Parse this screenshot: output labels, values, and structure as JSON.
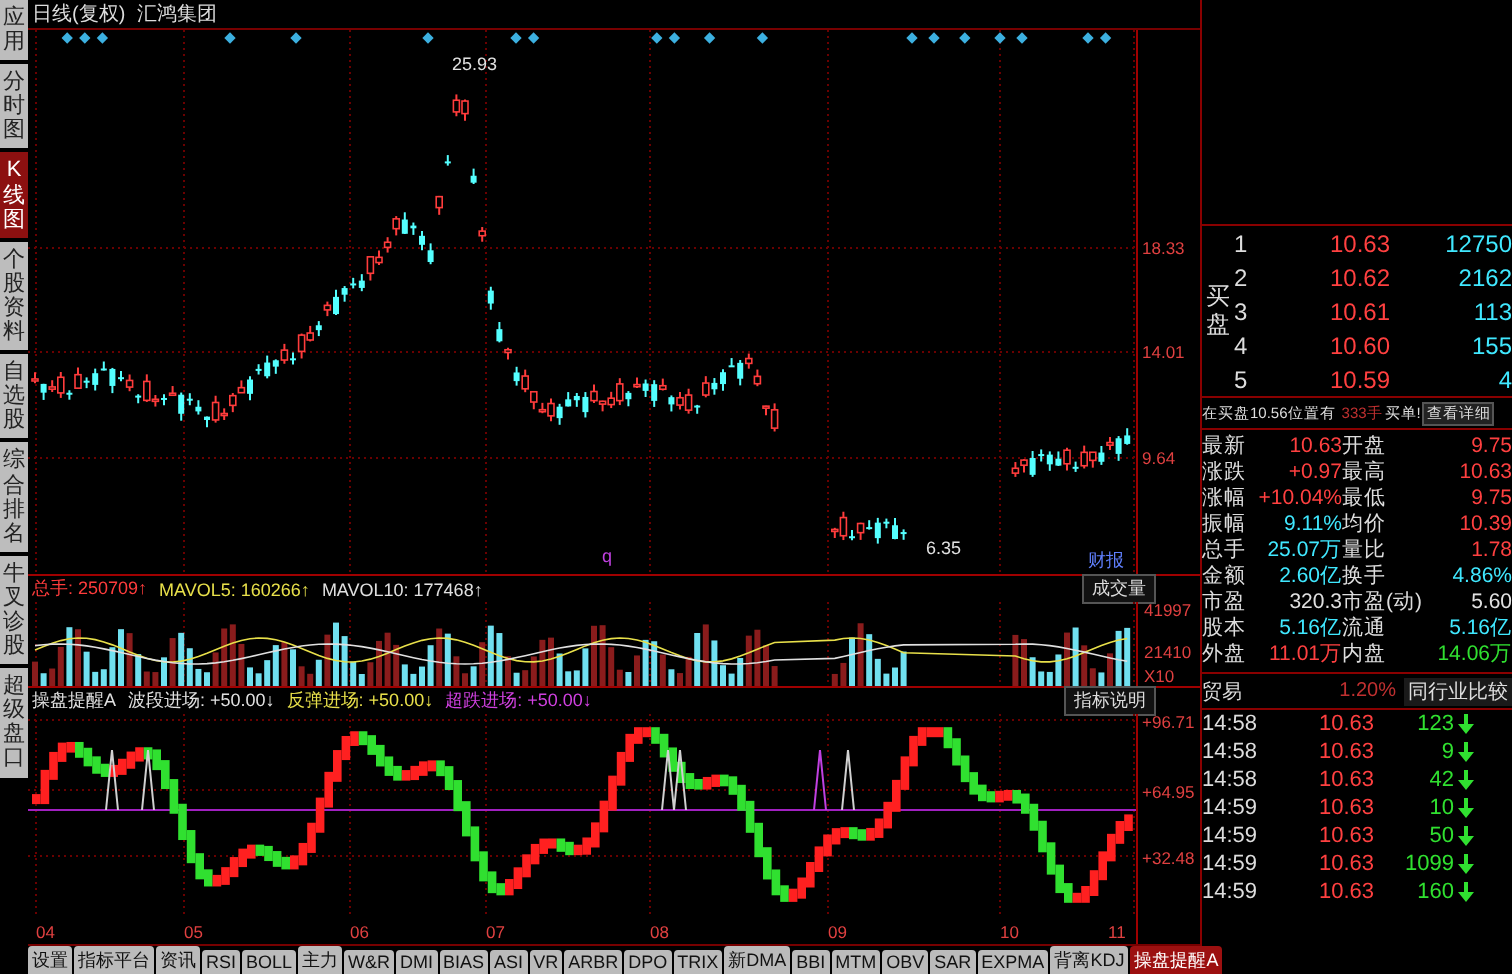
{
  "sidebar": {
    "items": [
      {
        "label": "应用",
        "selected": false
      },
      {
        "label": "分时图",
        "selected": false
      },
      {
        "label": "K线图",
        "selected": true
      },
      {
        "label": "个股资料",
        "selected": false
      },
      {
        "label": "自选股",
        "selected": false
      },
      {
        "label": "综合排名",
        "selected": false
      },
      {
        "label": "牛叉诊股",
        "selected": false
      },
      {
        "label": "超级盘口",
        "selected": false
      }
    ]
  },
  "chart_header": {
    "period": "日线(复权)",
    "stock_name": "汇鸿集团"
  },
  "price_chart": {
    "axis_labels": [
      "18.33",
      "14.01",
      "9.64"
    ],
    "high_label": "25.93",
    "low_label": "6.35",
    "marker": "q",
    "badge": "财报"
  },
  "volume_panel": {
    "legend": [
      {
        "name": "总手:",
        "value": "250709↑",
        "color": "#ff3c3c"
      },
      {
        "name": "MAVOL5:",
        "value": "160266↑",
        "color": "#e8e04a"
      },
      {
        "name": "MAVOL10:",
        "value": "177468↑",
        "color": "#e0e0e0"
      }
    ],
    "selector": "成交量",
    "axis_labels": [
      "41997",
      "21410",
      "X10"
    ]
  },
  "indicator_panel": {
    "name": "操盘提醒A",
    "legend": [
      {
        "name": "波段进场:",
        "value": "+50.00↓",
        "color": "#e0e0e0"
      },
      {
        "name": "反弹进场:",
        "value": "+50.00↓",
        "color": "#e8e04a"
      },
      {
        "name": "超跌进场:",
        "value": "+50.00↓",
        "color": "#d040e0"
      }
    ],
    "button": "指标说明",
    "axis_labels": [
      "+96.71",
      "+64.95",
      "+32.48"
    ]
  },
  "x_axis": {
    "labels": [
      "04",
      "05",
      "06",
      "07",
      "08",
      "09",
      "10",
      "11"
    ]
  },
  "tabs": [
    {
      "label": "设置",
      "selected": false
    },
    {
      "label": "指标平台",
      "selected": false
    },
    {
      "label": "资讯",
      "selected": false
    },
    {
      "label": "RSI",
      "selected": false
    },
    {
      "label": "BOLL",
      "selected": false
    },
    {
      "label": "主力",
      "selected": false
    },
    {
      "label": "W&R",
      "selected": false
    },
    {
      "label": "DMI",
      "selected": false
    },
    {
      "label": "BIAS",
      "selected": false
    },
    {
      "label": "ASI",
      "selected": false
    },
    {
      "label": "VR",
      "selected": false
    },
    {
      "label": "ARBR",
      "selected": false
    },
    {
      "label": "DPO",
      "selected": false
    },
    {
      "label": "TRIX",
      "selected": false
    },
    {
      "label": "新DMA",
      "selected": false
    },
    {
      "label": "BBI",
      "selected": false
    },
    {
      "label": "MTM",
      "selected": false
    },
    {
      "label": "OBV",
      "selected": false
    },
    {
      "label": "SAR",
      "selected": false
    },
    {
      "label": "EXPMA",
      "selected": false
    },
    {
      "label": "背离KDJ",
      "selected": false
    },
    {
      "label": "操盘提醒A",
      "selected": true
    }
  ],
  "order_book": {
    "side_label": "买盘",
    "rows": [
      {
        "level": "1",
        "price": "10.63",
        "volume": "12750"
      },
      {
        "level": "2",
        "price": "10.62",
        "volume": "2162"
      },
      {
        "level": "3",
        "price": "10.61",
        "volume": "113"
      },
      {
        "level": "4",
        "price": "10.60",
        "volume": "155"
      },
      {
        "level": "5",
        "price": "10.59",
        "volume": "4"
      }
    ]
  },
  "notice": {
    "text": "在买盘10.56位置有",
    "volume": "333手",
    "alert": "买单!",
    "link": "查看详细"
  },
  "quote": [
    {
      "label": "最新",
      "value": "10.63",
      "color": "#ff4040"
    },
    {
      "label": "开盘",
      "value": "9.75",
      "color": "#ff4040"
    },
    {
      "label": "涨跌",
      "value": "+0.97",
      "color": "#ff4040"
    },
    {
      "label": "最高",
      "value": "10.63",
      "color": "#ff4040"
    },
    {
      "label": "涨幅",
      "value": "+10.04%",
      "color": "#ff4040"
    },
    {
      "label": "最低",
      "value": "9.75",
      "color": "#ff4040"
    },
    {
      "label": "振幅",
      "value": "9.11%",
      "color": "#40e8ff"
    },
    {
      "label": "均价",
      "value": "10.39",
      "color": "#ff4040"
    },
    {
      "label": "总手",
      "value": "25.07万",
      "color": "#40e8ff"
    },
    {
      "label": "量比",
      "value": "1.78",
      "color": "#ff4040"
    },
    {
      "label": "金额",
      "value": "2.60亿",
      "color": "#40e8ff"
    },
    {
      "label": "换手",
      "value": "4.86%",
      "color": "#40e8ff"
    },
    {
      "label": "市盈",
      "value": "320.3",
      "color": "#e0e0e0"
    },
    {
      "label": "市盈(动)",
      "value": "5.60",
      "color": "#e0e0e0"
    },
    {
      "label": "股本",
      "value": "5.16亿",
      "color": "#40e8ff"
    },
    {
      "label": "流通",
      "value": "5.16亿",
      "color": "#40e8ff"
    },
    {
      "label": "外盘",
      "value": "11.01万",
      "color": "#ff4040"
    },
    {
      "label": "内盘",
      "value": "14.06万",
      "color": "#30e030"
    }
  ],
  "industry": {
    "name": "贸易",
    "change": "1.20%",
    "button": "同行业比较"
  },
  "trades": [
    {
      "time": "14:58",
      "price": "10.63",
      "volume": "123",
      "kind": "sell"
    },
    {
      "time": "14:58",
      "price": "10.63",
      "volume": "9",
      "kind": "sell"
    },
    {
      "time": "14:58",
      "price": "10.63",
      "volume": "42",
      "kind": "sell"
    },
    {
      "time": "14:59",
      "price": "10.63",
      "volume": "10",
      "kind": "sell"
    },
    {
      "time": "14:59",
      "price": "10.63",
      "volume": "50",
      "kind": "sell"
    },
    {
      "time": "14:59",
      "price": "10.63",
      "volume": "1099",
      "kind": "sell"
    },
    {
      "time": "14:59",
      "price": "10.63",
      "volume": "160",
      "kind": "sell"
    }
  ]
}
